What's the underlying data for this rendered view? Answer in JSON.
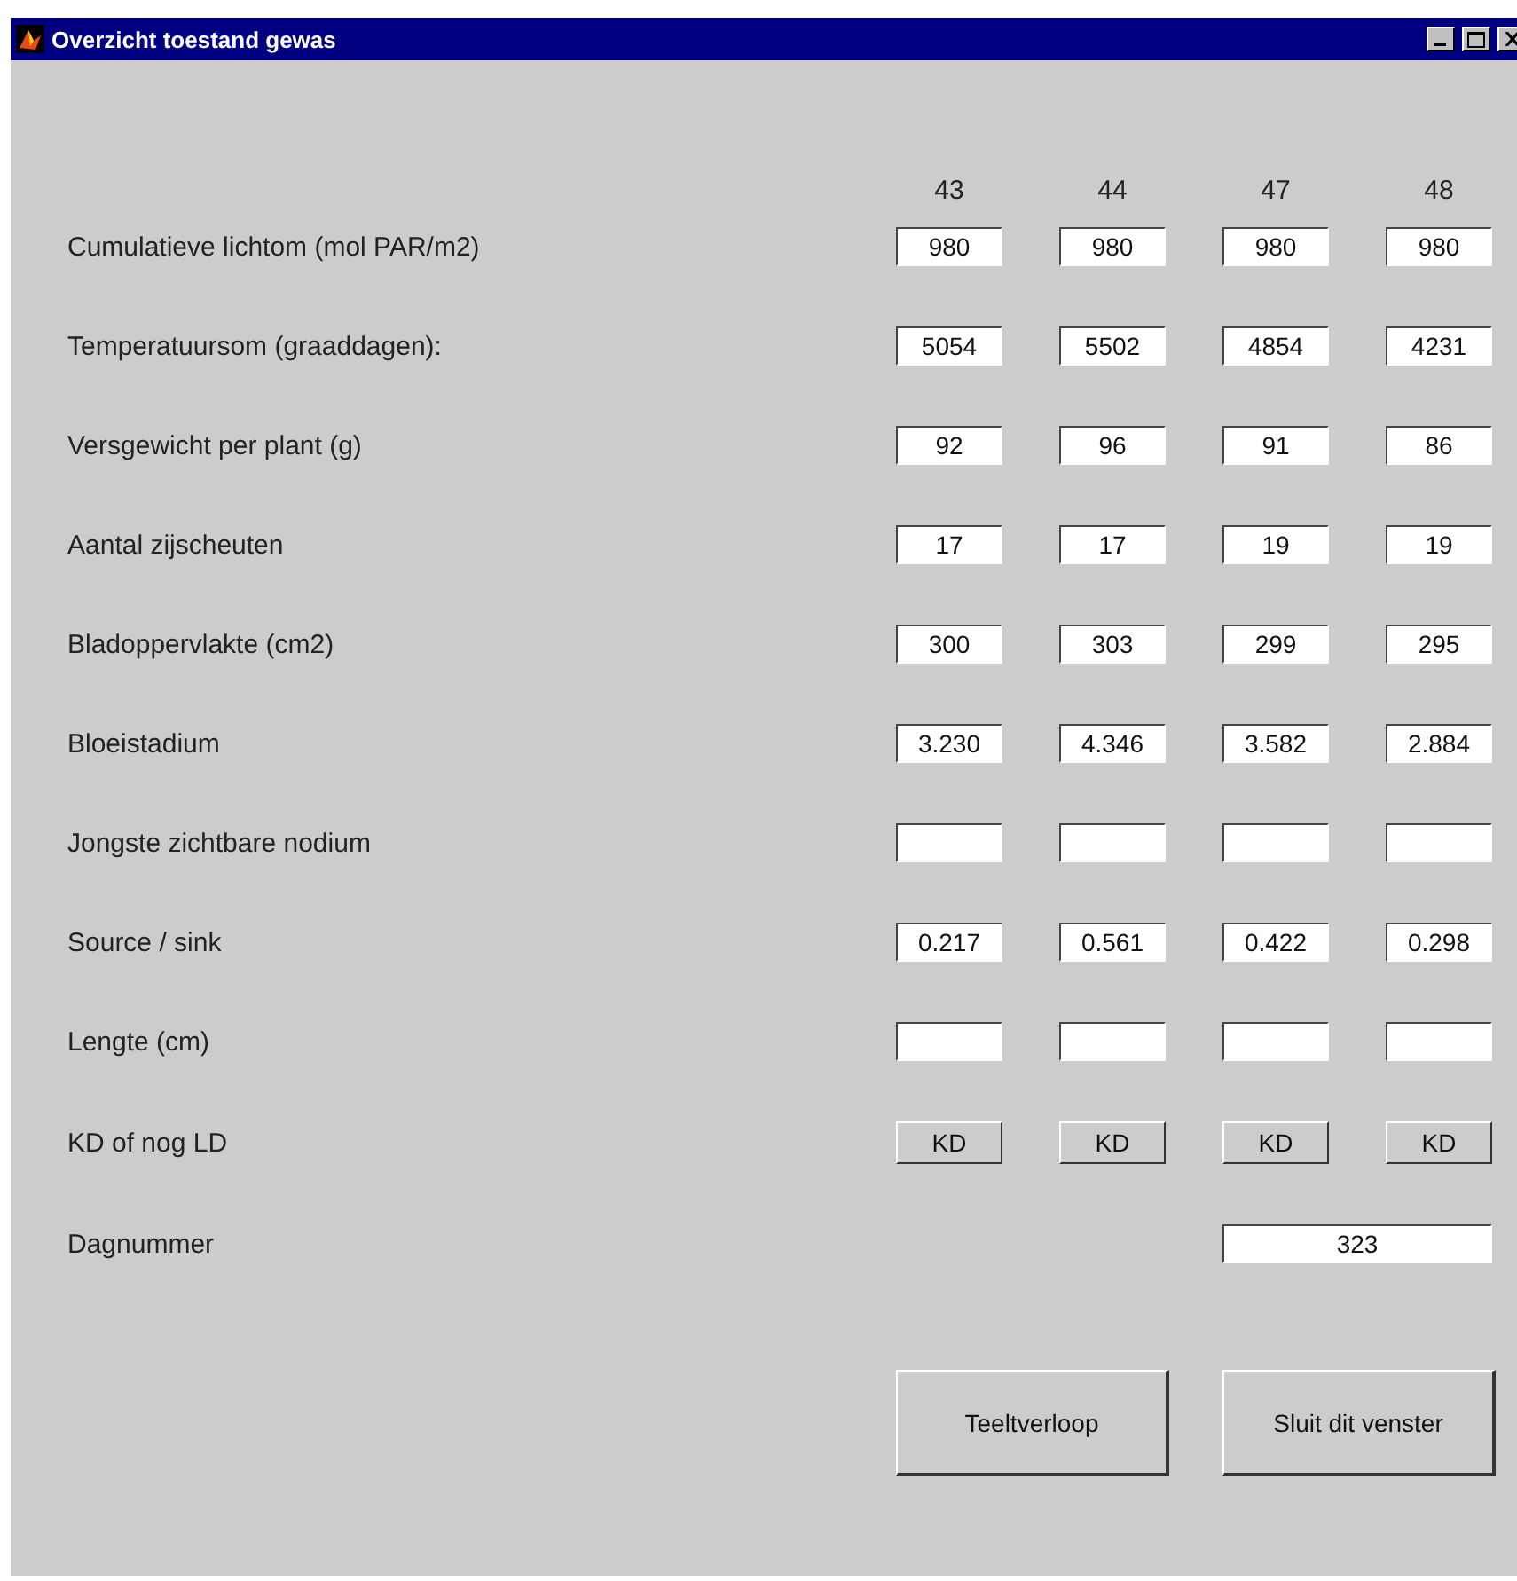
{
  "window": {
    "title": "Overzicht toestand gewas"
  },
  "columns": [
    "43",
    "44",
    "47",
    "48"
  ],
  "rows": [
    {
      "label": "Cumulatieve lichtom (mol PAR/m2)",
      "kind": "fields",
      "values": [
        "980",
        "980",
        "980",
        "980"
      ]
    },
    {
      "label": "Temperatuursom (graaddagen):",
      "kind": "fields",
      "values": [
        "5054",
        "5502",
        "4854",
        "4231"
      ]
    },
    {
      "label": "Versgewicht per plant (g)",
      "kind": "fields",
      "values": [
        "92",
        "96",
        "91",
        "86"
      ]
    },
    {
      "label": "Aantal zijscheuten",
      "kind": "fields",
      "values": [
        "17",
        "17",
        "19",
        "19"
      ]
    },
    {
      "label": "Bladoppervlakte (cm2)",
      "kind": "fields",
      "values": [
        "300",
        "303",
        "299",
        "295"
      ]
    },
    {
      "label": "Bloeistadium",
      "kind": "fields",
      "values": [
        "3.230",
        "4.346",
        "3.582",
        "2.884"
      ]
    },
    {
      "label": "Jongste zichtbare nodium",
      "kind": "blank"
    },
    {
      "label": "Source / sink",
      "kind": "fields",
      "values": [
        "0.217",
        "0.561",
        "0.422",
        "0.298"
      ]
    },
    {
      "label": "Lengte (cm)",
      "kind": "blank"
    },
    {
      "label": "KD of nog LD",
      "kind": "toggles",
      "values": [
        "KD",
        "KD",
        "KD",
        "KD"
      ]
    }
  ],
  "day": {
    "label": "Dagnummer",
    "value": "323"
  },
  "buttons": [
    "Teeltverloop",
    "Sluit dit venster"
  ]
}
